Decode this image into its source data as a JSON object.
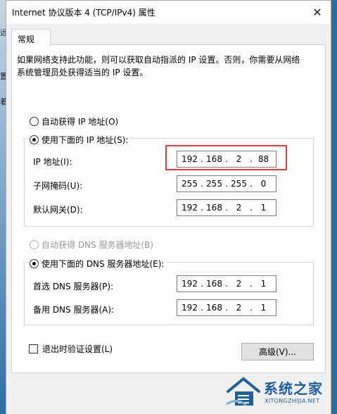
{
  "window": {
    "title": "Internet 协议版本 4 (TCP/IPv4) 属性",
    "close_glyph": "✕"
  },
  "background": {
    "fragments": [
      "远",
      "置",
      "着"
    ]
  },
  "tabs": [
    {
      "label": "常规",
      "active": true
    }
  ],
  "intro_text": "如果网络支持此功能，则可以获取自动指派的 IP 设置。否则，你需要从网络系统管理员处获得适当的 IP 设置。",
  "ip_section": {
    "auto_radio": {
      "label": "自动获得 IP 地址(O)",
      "checked": false
    },
    "manual_radio": {
      "label": "使用下面的 IP 地址(S):",
      "checked": true
    },
    "fields": [
      {
        "label": "IP 地址(I):",
        "octets": [
          "192",
          "168",
          "2",
          "88"
        ]
      },
      {
        "label": "子网掩码(U):",
        "octets": [
          "255",
          "255",
          "255",
          "0"
        ]
      },
      {
        "label": "默认网关(D):",
        "octets": [
          "192",
          "168",
          "2",
          "1"
        ]
      }
    ]
  },
  "dns_section": {
    "auto_radio": {
      "label": "自动获得 DNS 服务器地址(B)",
      "checked": false,
      "disabled": true
    },
    "manual_radio": {
      "label": "使用下面的 DNS 服务器地址(E):",
      "checked": true
    },
    "fields": [
      {
        "label": "首选 DNS 服务器(P):",
        "octets": [
          "192",
          "168",
          "2",
          "1"
        ]
      },
      {
        "label": "备用 DNS 服务器(A):",
        "octets": [
          "192",
          "168",
          "2",
          "1"
        ]
      }
    ]
  },
  "validate_checkbox": {
    "label": "退出时验证设置(L)",
    "checked": false
  },
  "advanced_button": {
    "label": "高级(V)..."
  },
  "watermark": {
    "title": "系统之家",
    "url": "XITONGZHIJIA.NET"
  },
  "colors": {
    "highlight_box": "#e23b3b",
    "watermark": "#1f5f9c"
  }
}
